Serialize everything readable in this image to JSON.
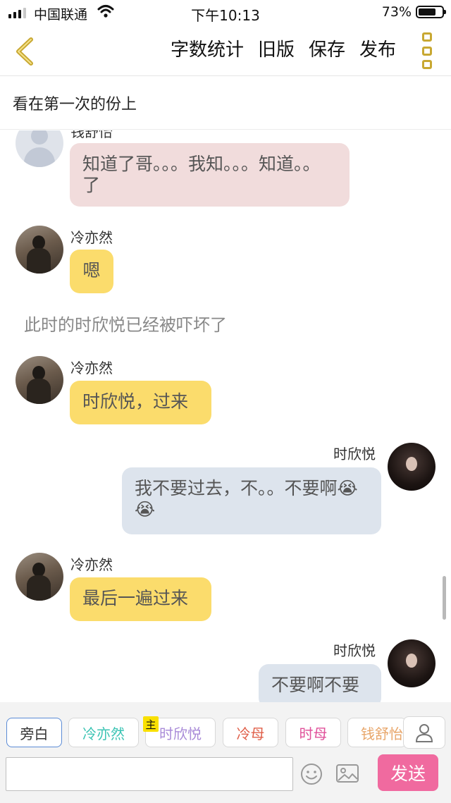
{
  "status_bar": {
    "carrier": "中国联通",
    "time": "下午10:13",
    "battery_percent": "73%"
  },
  "nav": {
    "back_icon": "chevron-left-icon",
    "actions": [
      "字数统计",
      "旧版",
      "保存",
      "发布"
    ],
    "more_icon": "more-vertical-icon",
    "accent_color": "#c8a832"
  },
  "chapter": {
    "title": "看在第一次的份上"
  },
  "chat": {
    "messages": [
      {
        "speaker": "钱舒怡",
        "text": "知道了哥。。。我知。。。知道。。了",
        "side": "left",
        "bubble_color": "#f1dcdc"
      },
      {
        "speaker": "冷亦然",
        "text": "嗯",
        "side": "left",
        "bubble_color": "#fbdc6c"
      },
      {
        "narration": "此时的时欣悦已经被吓坏了"
      },
      {
        "speaker": "冷亦然",
        "text": "时欣悦，过来",
        "side": "left",
        "bubble_color": "#fbdc6c"
      },
      {
        "speaker": "时欣悦",
        "text": "我不要过去，不。。不要啊😭😭",
        "side": "right",
        "bubble_color": "#dde4ed"
      },
      {
        "speaker": "冷亦然",
        "text": "最后一遍过来",
        "side": "left",
        "bubble_color": "#fbdc6c"
      },
      {
        "speaker": "时欣悦",
        "text": "不要啊不要",
        "side": "right",
        "bubble_color": "#dde4ed"
      }
    ]
  },
  "roles": {
    "items": [
      {
        "label": "旁白",
        "color": "#333333",
        "border": "#5b8bd6"
      },
      {
        "label": "冷亦然",
        "color": "#3cc4b4",
        "border": "#d8d8d8"
      },
      {
        "label": "时欣悦",
        "color": "#a98bd8",
        "border": "#d8d8d8"
      },
      {
        "label": "冷母",
        "color": "#e0604a",
        "border": "#d8d8d8"
      },
      {
        "label": "时母",
        "color": "#e0509a",
        "border": "#d8d8d8"
      },
      {
        "label": "钱舒怡",
        "color": "#e8a66a",
        "border": "#d8d8d8"
      }
    ],
    "host_badge": "主",
    "profile_icon": "person-icon"
  },
  "input": {
    "value": "",
    "placeholder": "",
    "emoji_icon": "smiley-icon",
    "image_icon": "image-icon",
    "send_label": "发送",
    "send_color": "#f06a9f"
  }
}
